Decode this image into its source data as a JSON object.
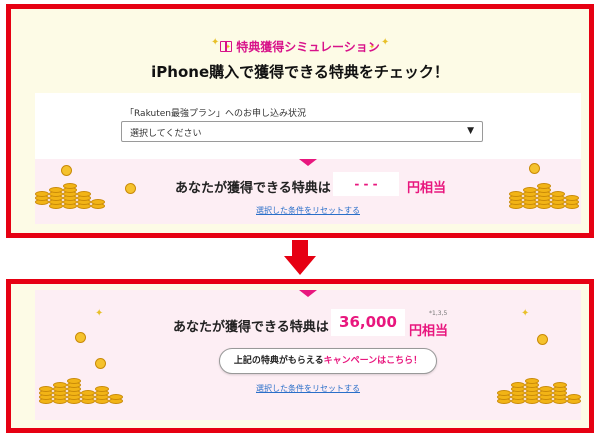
{
  "top_panel": {
    "badge": "特典獲得シミュレーション",
    "headline": "iPhone購入で獲得できる特典をチェック！",
    "form_label": "「Rakuten最強プラン」へのお申し込み状況",
    "select_value": "選択してください",
    "select_caret": "▼",
    "result_label": "あなたが獲得できる特典は",
    "result_value": "- - -",
    "unit": "円相当",
    "reset_link": "選択した条件をリセットする"
  },
  "bottom_panel": {
    "result_label": "あなたが獲得できる特典は",
    "result_value": "36,000",
    "unit": "円相当",
    "footnote": "*1,3,5",
    "cta_prefix": "上記の特典がもらえる",
    "cta_highlight": "キャンペーンはこちら！",
    "reset_link": "選択した条件をリセットする"
  },
  "icons": [
    "gift-icon",
    "sparkle-icon",
    "caret-down-icon",
    "down-arrow-icon",
    "coin-pile-icon"
  ],
  "colors": {
    "frame": "#e60012",
    "accent_pink": "#e8177e",
    "badge_magenta": "#d8128a",
    "link_blue": "#2a6fc9",
    "panel_bg": "#fdfbe6",
    "result_bg": "#fdeef4"
  }
}
